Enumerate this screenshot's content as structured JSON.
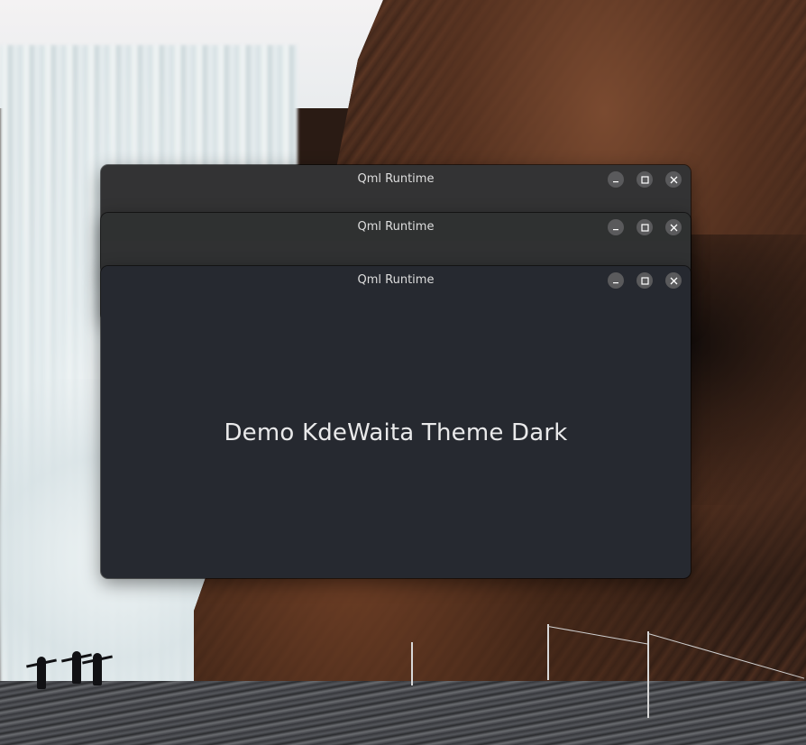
{
  "windows": [
    {
      "title": "Qml Runtime",
      "controls": {
        "minimize_icon": "minimize-icon",
        "maximize_icon": "maximize-icon",
        "close_icon": "close-icon"
      }
    },
    {
      "title": "Qml Runtime",
      "controls": {
        "minimize_icon": "minimize-icon",
        "maximize_icon": "maximize-icon",
        "close_icon": "close-icon"
      }
    },
    {
      "title": "Qml Runtime",
      "content_text": "Demo KdeWaita Theme Dark",
      "controls": {
        "minimize_icon": "minimize-icon",
        "maximize_icon": "maximize-icon",
        "close_icon": "close-icon"
      }
    }
  ],
  "colors": {
    "window_bg_dark": "#262930",
    "titlebar_back": "#333334",
    "titlebar_mid": "#2f3131",
    "control_button": "#5a5a5c",
    "text_primary": "#e9e9ea"
  }
}
